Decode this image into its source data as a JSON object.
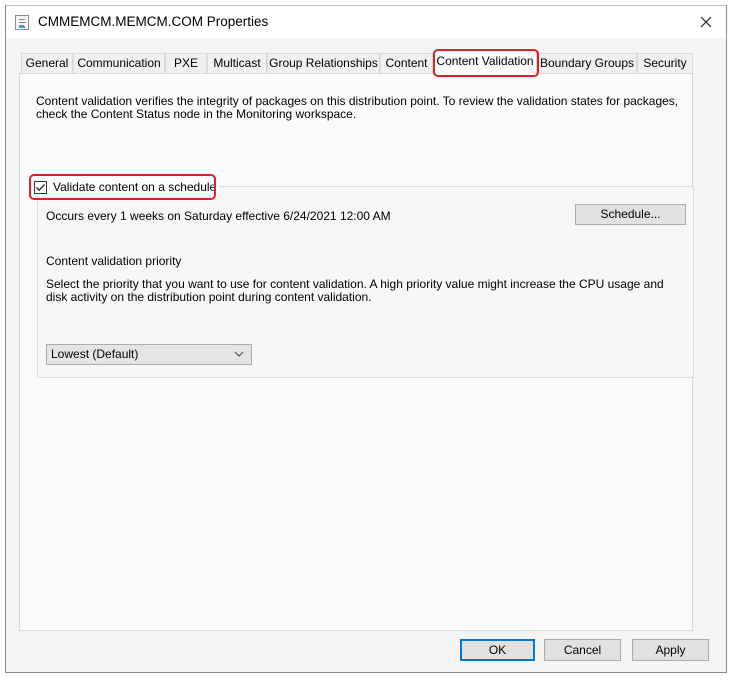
{
  "window": {
    "title": "CMMEMCM.MEMCM.COM Properties",
    "close_symbol": "✕"
  },
  "tabs": [
    {
      "label": "General",
      "active": false
    },
    {
      "label": "Communication",
      "active": false
    },
    {
      "label": "PXE",
      "active": false
    },
    {
      "label": "Multicast",
      "active": false
    },
    {
      "label": "Group Relationships",
      "active": false
    },
    {
      "label": "Content",
      "active": false
    },
    {
      "label": "Content Validation",
      "active": true
    },
    {
      "label": "Boundary Groups",
      "active": false
    },
    {
      "label": "Security",
      "active": false
    }
  ],
  "content_validation": {
    "description": "Content validation verifies the integrity of packages on this distribution point. To review the validation states for packages, check the Content Status node in the Monitoring workspace.",
    "schedule_checkbox": {
      "label": "Validate content on a schedule",
      "checked": true
    },
    "schedule_summary": "Occurs every 1 weeks on Saturday effective 6/24/2021 12:00 AM",
    "schedule_button": "Schedule...",
    "priority_label": "Content validation priority",
    "priority_description": "Select the priority that you want to use for content validation. A high priority value might increase the CPU usage and disk activity on the distribution point during content validation.",
    "priority_selected": "Lowest (Default)"
  },
  "footer": {
    "ok": "OK",
    "cancel": "Cancel",
    "apply": "Apply"
  },
  "colors": {
    "highlight": "#d9222a",
    "default_button_border": "#0078d7"
  }
}
